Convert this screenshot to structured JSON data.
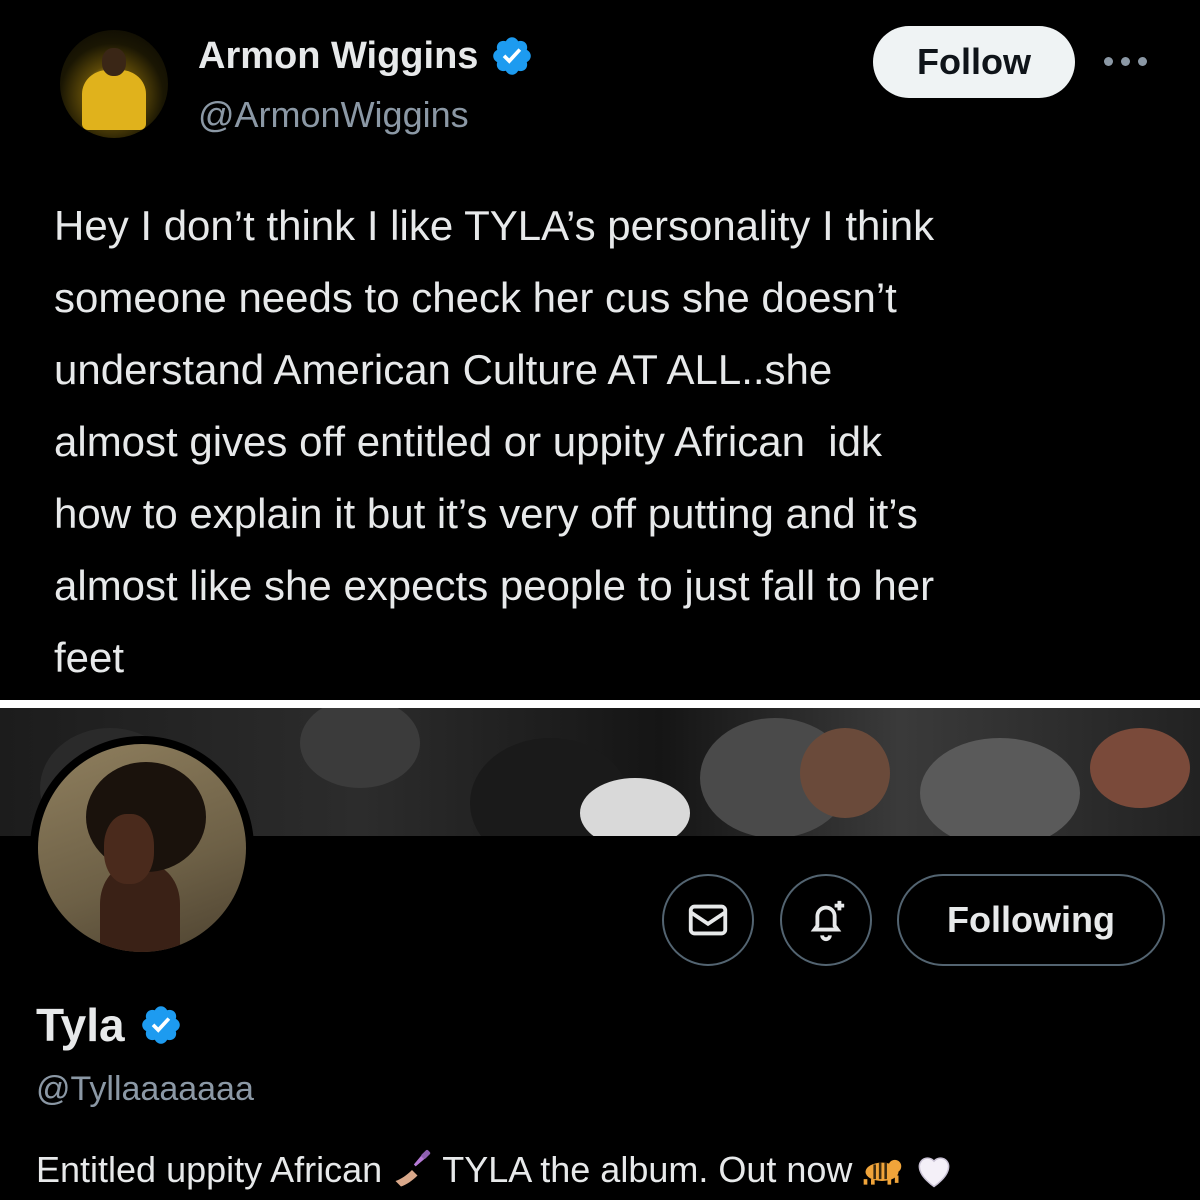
{
  "tweet": {
    "author_name": "Armon Wiggins",
    "author_handle": "@ArmonWiggins",
    "follow_label": "Follow",
    "text": "Hey I don’t think I like TYLA’s personality I think\nsomeone needs to check her cus she doesn’t\nunderstand American Culture AT ALL..she\nalmost gives off entitled or uppity African  idk\nhow to explain it but it’s very off putting and it’s\nalmost like she expects people to just fall to her\nfeet"
  },
  "profile": {
    "name": "Tyla",
    "handle": "@Tyllaaaaaaa",
    "following_label": "Following",
    "bio_part1": "Entitled uppity African",
    "bio_part2": "TYLA the album. Out now",
    "bio_icons": [
      "nail-polish-emoji",
      "tiger-emoji",
      "white-heart-emoji"
    ]
  },
  "colors": {
    "background": "#000000",
    "text": "#e7e9ea",
    "secondary_text": "#8b98a5",
    "verified_blue": "#1d9bf0",
    "button_border": "#536471",
    "follow_button_bg": "#eff3f4"
  }
}
